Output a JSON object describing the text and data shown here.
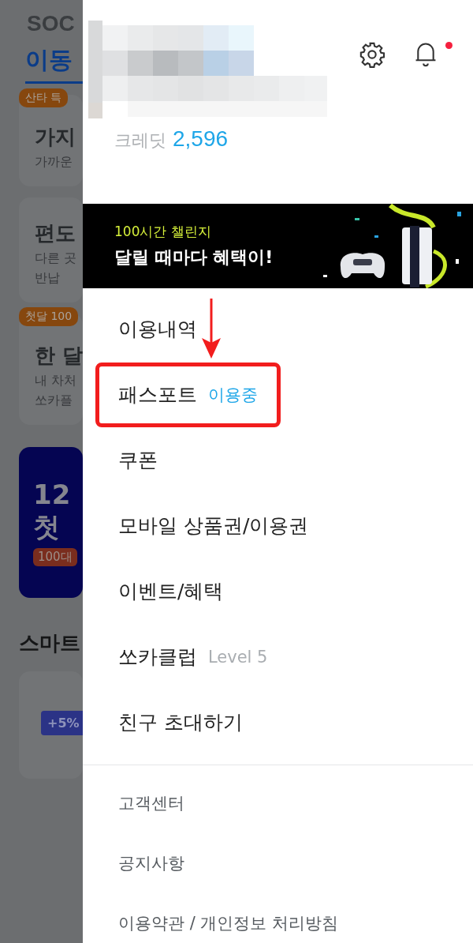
{
  "background": {
    "logo": "SOC",
    "tab": "이동",
    "cards": [
      {
        "badge": "산타 특",
        "title": "가지",
        "lines": [
          "가까운"
        ]
      },
      {
        "title": "편도",
        "lines": [
          "다른 곳",
          "반납"
        ]
      },
      {
        "badge": "첫달 100",
        "title": "한 달",
        "lines": [
          "내 차처",
          "쏘카플"
        ]
      }
    ],
    "promo": {
      "lines": [
        "12",
        "첫"
      ],
      "pill": "100대"
    },
    "section": "스마트",
    "chip": "+5%"
  },
  "drawer": {
    "credit_label": "크레딧",
    "credit_value": "2,596",
    "notification": true,
    "banner": {
      "kicker": "100시간 챌린지",
      "headline": "달릴 때마다 혜택이!"
    },
    "items": [
      {
        "kind": "main",
        "label": "이용내역",
        "highlighted": false
      },
      {
        "kind": "main",
        "label": "패스포트",
        "badge": {
          "text": "이용중",
          "color": "#1ea6e8"
        },
        "highlighted": true
      },
      {
        "kind": "main",
        "label": "쿠폰",
        "highlighted": false
      },
      {
        "kind": "main",
        "label": "모바일 상품권/이용권",
        "highlighted": false
      },
      {
        "kind": "main",
        "label": "이벤트/혜택",
        "highlighted": false
      },
      {
        "kind": "main",
        "label": "쏘카클럽",
        "badge": {
          "text": "Level 5",
          "color": "#a9adb1"
        },
        "highlighted": false
      },
      {
        "kind": "main",
        "label": "친구 초대하기",
        "highlighted": false
      },
      {
        "kind": "divider"
      },
      {
        "kind": "secondary",
        "label": "고객센터",
        "highlighted": false
      },
      {
        "kind": "secondary",
        "label": "공지사항",
        "highlighted": false
      },
      {
        "kind": "secondary",
        "label": "이용약관 / 개인정보 처리방침",
        "highlighted": false
      }
    ]
  }
}
